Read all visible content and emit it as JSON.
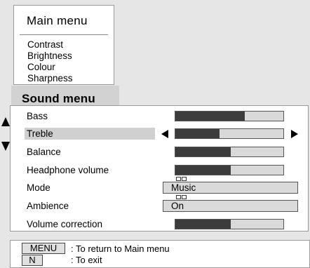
{
  "main_menu": {
    "title": "Main menu",
    "items": [
      "Contrast",
      "Brightness",
      "Colour",
      "Sharpness"
    ]
  },
  "sound_menu": {
    "title": "Sound menu",
    "rows": [
      {
        "label": "Bass",
        "type": "bar",
        "level": 0.64
      },
      {
        "label": "Treble",
        "type": "bar",
        "level": 0.41,
        "selected": true
      },
      {
        "label": "Balance",
        "type": "bar",
        "level": 0.51
      },
      {
        "label": "Headphone volume",
        "type": "bar",
        "level": 0.51
      },
      {
        "label": "Mode",
        "type": "value",
        "value": "Music"
      },
      {
        "label": "Ambience",
        "type": "value",
        "value": "On"
      },
      {
        "label": "Volume correction",
        "type": "bar",
        "level": 0.51
      }
    ]
  },
  "help": {
    "menu_key": "MENU",
    "menu_text": ": To return to Main menu",
    "n_key": "N",
    "n_text": ": To exit"
  },
  "colors": {
    "bar_fill": "#3c3c3c",
    "bar_track": "#d9d9d9",
    "highlight": "#d0d0d0",
    "background": "#e6e6e6"
  }
}
